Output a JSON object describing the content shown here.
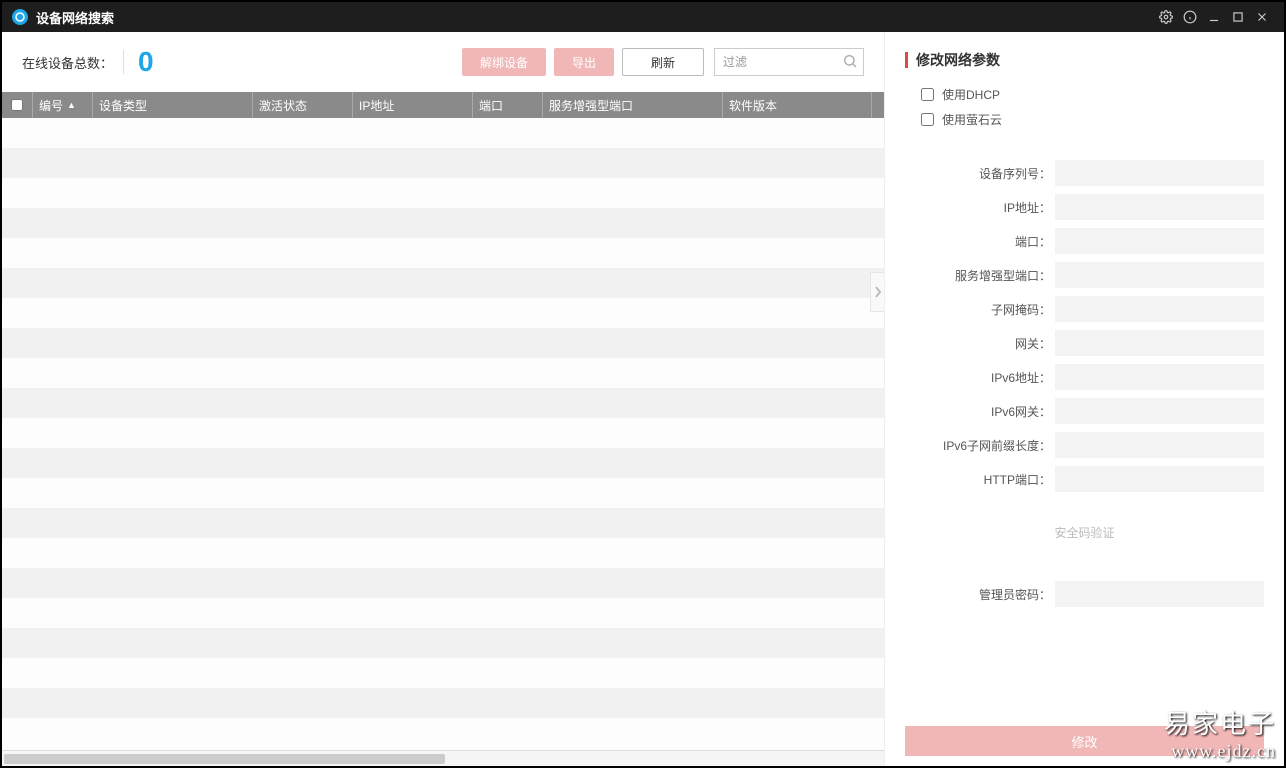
{
  "window": {
    "title": "设备网络搜索"
  },
  "toolbar": {
    "device_count_label": "在线设备总数：",
    "device_count": "0",
    "unbind_label": "解绑设备",
    "export_label": "导出",
    "refresh_label": "刷新",
    "filter_placeholder": "过滤"
  },
  "columns": {
    "serial": "编号",
    "device_type": "设备类型",
    "activation": "激活状态",
    "ip": "IP地址",
    "port": "端口",
    "service_port": "服务增强型端口",
    "version": "软件版本"
  },
  "right_panel": {
    "title": "修改网络参数",
    "use_dhcp": "使用DHCP",
    "use_ezviz": "使用萤石云",
    "fields": {
      "serial": "设备序列号：",
      "ip": "IP地址：",
      "port": "端口：",
      "service_port": "服务增强型端口：",
      "subnet": "子网掩码：",
      "gateway": "网关：",
      "ipv6": "IPv6地址：",
      "ipv6_gateway": "IPv6网关：",
      "ipv6_prefix": "IPv6子网前缀长度：",
      "http_port": "HTTP端口："
    },
    "security_header": "安全码验证",
    "admin_password": "管理员密码：",
    "modify_label": "修改"
  },
  "watermark": {
    "line1": "易家电子",
    "line2": "www.ejdz.cn"
  }
}
